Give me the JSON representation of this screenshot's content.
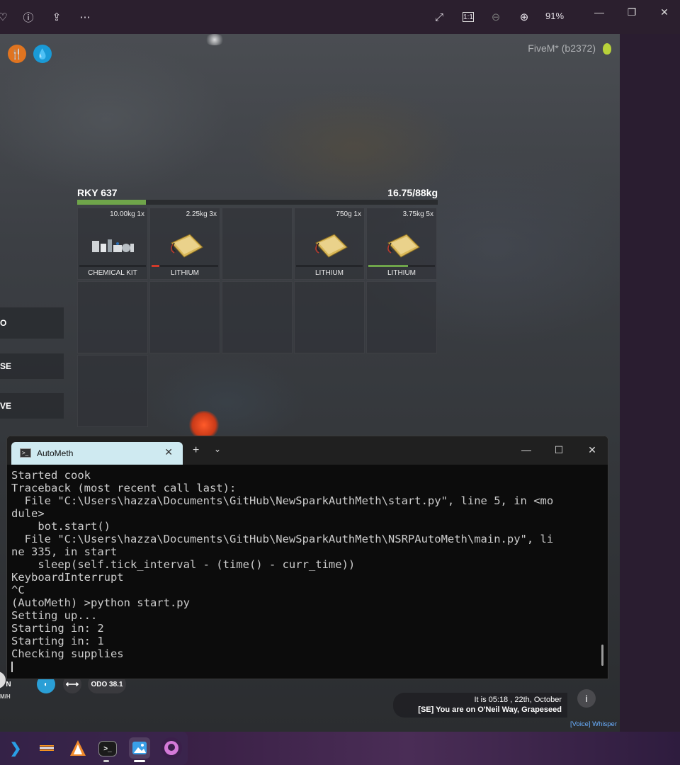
{
  "viewer": {
    "zoom": "91%"
  },
  "game": {
    "fivem_label": "FiveM* (b2372)",
    "inventory": {
      "plate": "RKY 637",
      "weight": "16.75/88kg",
      "weight_fraction": 0.19,
      "slots": [
        {
          "meta": "10.00kg 1x",
          "label": "CHEMICAL KIT",
          "kind": "kit",
          "durability": 0,
          "dur_color": ""
        },
        {
          "meta": "2.25kg 3x",
          "label": "LITHIUM",
          "kind": "battery",
          "durability": 0.12,
          "dur_color": "#d23a2a"
        },
        {
          "meta": "",
          "label": "",
          "kind": "empty",
          "durability": 0,
          "dur_color": ""
        },
        {
          "meta": "750g 1x",
          "label": "LITHIUM",
          "kind": "battery",
          "durability": 0,
          "dur_color": ""
        },
        {
          "meta": "3.75kg 5x",
          "label": "LITHIUM",
          "kind": "battery",
          "durability": 0.6,
          "dur_color": "#6fa54a"
        }
      ]
    },
    "side_buttons": [
      "O",
      "SE",
      "VE"
    ],
    "hud": {
      "gear": "N",
      "odo": "ODO 38.1",
      "speed_unit": "M/H",
      "time_line": "It is 05:18 , 22th, October",
      "loc_prefix": "[SE]",
      "loc_text": "You are on O'Neil Way, Grapeseed",
      "voice": "[Voice] Whisper"
    }
  },
  "terminal": {
    "tab_title": "AutoMeth",
    "lines": [
      "Started cook",
      "Traceback (most recent call last):",
      "  File \"C:\\Users\\hazza\\Documents\\GitHub\\NewSparkAuthMeth\\start.py\", line 5, in <mo",
      "dule>",
      "    bot.start()",
      "  File \"C:\\Users\\hazza\\Documents\\GitHub\\NewSparkAuthMeth\\NSRPAutoMeth\\main.py\", li",
      "ne 335, in start",
      "    sleep(self.tick_interval - (time() - curr_time))",
      "KeyboardInterrupt",
      "^C",
      "(AutoMeth) >python start.py",
      "Setting up...",
      "Starting in: 2",
      "Starting in: 1",
      "Checking supplies"
    ]
  },
  "taskbar": {
    "apps": [
      "vscode-icon",
      "eclipse-icon",
      "app-icon",
      "terminal-icon",
      "photos-icon",
      "github-icon"
    ]
  },
  "colors": {
    "terminal_tab": "#cfeaf1",
    "weight_bar": "#6fa54a",
    "voice": "#6ab0ff"
  }
}
